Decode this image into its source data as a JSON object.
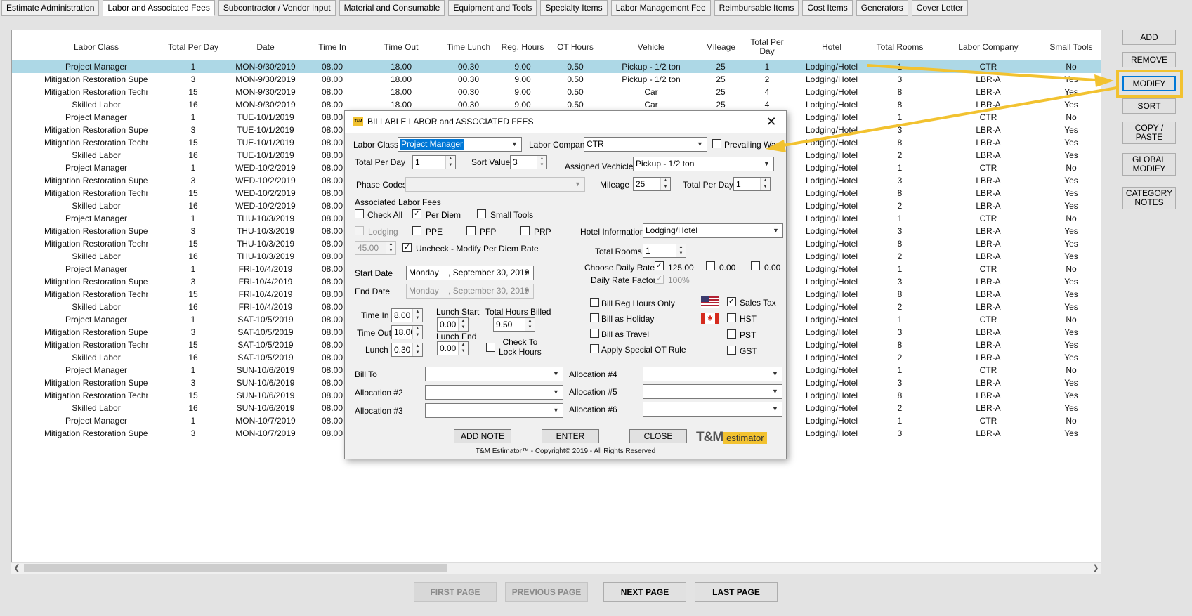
{
  "tabs": [
    "Estimate Administration",
    "Labor and Associated Fees",
    "Subcontractor / Vendor Input",
    "Material and Consumable",
    "Equipment and Tools",
    "Specialty Items",
    "Labor Management Fee",
    "Reimbursable Items",
    "Cost Items",
    "Generators",
    "Cover Letter"
  ],
  "active_tab": "Labor and Associated Fees",
  "grid": {
    "columns": [
      "Labor Class",
      "Total Per Day",
      "Date",
      "Time In",
      "Time Out",
      "Time Lunch",
      "Reg. Hours",
      "OT Hours",
      "Vehicle",
      "Mileage",
      "Total Per Day",
      "Hotel",
      "Total Rooms",
      "Labor Company",
      "Small Tools"
    ],
    "rows": [
      [
        "Project Manager",
        "1",
        "MON-9/30/2019",
        "08.00",
        "18.00",
        "00.30",
        "9.00",
        "0.50",
        "Pickup - 1/2 ton",
        "25",
        "1",
        "Lodging/Hotel",
        "1",
        "CTR",
        "No"
      ],
      [
        "Mitigation Restoration Supervisor",
        "3",
        "MON-9/30/2019",
        "08.00",
        "18.00",
        "00.30",
        "9.00",
        "0.50",
        "Pickup - 1/2 ton",
        "25",
        "2",
        "Lodging/Hotel",
        "3",
        "LBR-A",
        "Yes"
      ],
      [
        "Mitigation Restoration Technician",
        "15",
        "MON-9/30/2019",
        "08.00",
        "18.00",
        "00.30",
        "9.00",
        "0.50",
        "Car",
        "25",
        "4",
        "Lodging/Hotel",
        "8",
        "LBR-A",
        "Yes"
      ],
      [
        "Skilled Labor",
        "16",
        "MON-9/30/2019",
        "08.00",
        "18.00",
        "00.30",
        "9.00",
        "0.50",
        "Car",
        "25",
        "4",
        "Lodging/Hotel",
        "8",
        "LBR-A",
        "Yes"
      ],
      [
        "Project Manager",
        "1",
        "TUE-10/1/2019",
        "08.00",
        "",
        "",
        "",
        "",
        "",
        "",
        "",
        "Lodging/Hotel",
        "1",
        "CTR",
        "No"
      ],
      [
        "Mitigation Restoration Supervisor",
        "3",
        "TUE-10/1/2019",
        "08.00",
        "",
        "",
        "",
        "",
        "",
        "",
        "",
        "Lodging/Hotel",
        "3",
        "LBR-A",
        "Yes"
      ],
      [
        "Mitigation Restoration Technician",
        "15",
        "TUE-10/1/2019",
        "08.00",
        "",
        "",
        "",
        "",
        "",
        "",
        "",
        "Lodging/Hotel",
        "8",
        "LBR-A",
        "Yes"
      ],
      [
        "Skilled Labor",
        "16",
        "TUE-10/1/2019",
        "08.00",
        "",
        "",
        "",
        "",
        "",
        "",
        "",
        "Lodging/Hotel",
        "2",
        "LBR-A",
        "Yes"
      ],
      [
        "Project Manager",
        "1",
        "WED-10/2/2019",
        "08.00",
        "",
        "",
        "",
        "",
        "",
        "",
        "",
        "Lodging/Hotel",
        "1",
        "CTR",
        "No"
      ],
      [
        "Mitigation Restoration Supervisor",
        "3",
        "WED-10/2/2019",
        "08.00",
        "",
        "",
        "",
        "",
        "",
        "",
        "",
        "Lodging/Hotel",
        "3",
        "LBR-A",
        "Yes"
      ],
      [
        "Mitigation Restoration Technician",
        "15",
        "WED-10/2/2019",
        "08.00",
        "",
        "",
        "",
        "",
        "",
        "",
        "",
        "Lodging/Hotel",
        "8",
        "LBR-A",
        "Yes"
      ],
      [
        "Skilled Labor",
        "16",
        "WED-10/2/2019",
        "08.00",
        "",
        "",
        "",
        "",
        "",
        "",
        "",
        "Lodging/Hotel",
        "2",
        "LBR-A",
        "Yes"
      ],
      [
        "Project Manager",
        "1",
        "THU-10/3/2019",
        "08.00",
        "",
        "",
        "",
        "",
        "",
        "",
        "",
        "Lodging/Hotel",
        "1",
        "CTR",
        "No"
      ],
      [
        "Mitigation Restoration Supervisor",
        "3",
        "THU-10/3/2019",
        "08.00",
        "",
        "",
        "",
        "",
        "",
        "",
        "",
        "Lodging/Hotel",
        "3",
        "LBR-A",
        "Yes"
      ],
      [
        "Mitigation Restoration Technician",
        "15",
        "THU-10/3/2019",
        "08.00",
        "",
        "",
        "",
        "",
        "",
        "",
        "",
        "Lodging/Hotel",
        "8",
        "LBR-A",
        "Yes"
      ],
      [
        "Skilled Labor",
        "16",
        "THU-10/3/2019",
        "08.00",
        "",
        "",
        "",
        "",
        "",
        "",
        "",
        "Lodging/Hotel",
        "2",
        "LBR-A",
        "Yes"
      ],
      [
        "Project Manager",
        "1",
        "FRI-10/4/2019",
        "08.00",
        "",
        "",
        "",
        "",
        "",
        "",
        "",
        "Lodging/Hotel",
        "1",
        "CTR",
        "No"
      ],
      [
        "Mitigation Restoration Supervisor",
        "3",
        "FRI-10/4/2019",
        "08.00",
        "",
        "",
        "",
        "",
        "",
        "",
        "",
        "Lodging/Hotel",
        "3",
        "LBR-A",
        "Yes"
      ],
      [
        "Mitigation Restoration Technician",
        "15",
        "FRI-10/4/2019",
        "08.00",
        "",
        "",
        "",
        "",
        "",
        "",
        "",
        "Lodging/Hotel",
        "8",
        "LBR-A",
        "Yes"
      ],
      [
        "Skilled Labor",
        "16",
        "FRI-10/4/2019",
        "08.00",
        "",
        "",
        "",
        "",
        "",
        "",
        "",
        "Lodging/Hotel",
        "2",
        "LBR-A",
        "Yes"
      ],
      [
        "Project Manager",
        "1",
        "SAT-10/5/2019",
        "08.00",
        "",
        "",
        "",
        "",
        "",
        "",
        "",
        "Lodging/Hotel",
        "1",
        "CTR",
        "No"
      ],
      [
        "Mitigation Restoration Supervisor",
        "3",
        "SAT-10/5/2019",
        "08.00",
        "",
        "",
        "",
        "",
        "",
        "",
        "",
        "Lodging/Hotel",
        "3",
        "LBR-A",
        "Yes"
      ],
      [
        "Mitigation Restoration Technician",
        "15",
        "SAT-10/5/2019",
        "08.00",
        "",
        "",
        "",
        "",
        "",
        "",
        "",
        "Lodging/Hotel",
        "8",
        "LBR-A",
        "Yes"
      ],
      [
        "Skilled Labor",
        "16",
        "SAT-10/5/2019",
        "08.00",
        "",
        "",
        "",
        "",
        "",
        "",
        "",
        "Lodging/Hotel",
        "2",
        "LBR-A",
        "Yes"
      ],
      [
        "Project Manager",
        "1",
        "SUN-10/6/2019",
        "08.00",
        "",
        "",
        "",
        "",
        "",
        "",
        "",
        "Lodging/Hotel",
        "1",
        "CTR",
        "No"
      ],
      [
        "Mitigation Restoration Supervisor",
        "3",
        "SUN-10/6/2019",
        "08.00",
        "",
        "",
        "",
        "",
        "",
        "",
        "",
        "Lodging/Hotel",
        "3",
        "LBR-A",
        "Yes"
      ],
      [
        "Mitigation Restoration Technician",
        "15",
        "SUN-10/6/2019",
        "08.00",
        "",
        "",
        "",
        "",
        "",
        "",
        "",
        "Lodging/Hotel",
        "8",
        "LBR-A",
        "Yes"
      ],
      [
        "Skilled Labor",
        "16",
        "SUN-10/6/2019",
        "08.00",
        "",
        "",
        "",
        "",
        "",
        "",
        "",
        "Lodging/Hotel",
        "2",
        "LBR-A",
        "Yes"
      ],
      [
        "Project Manager",
        "1",
        "MON-10/7/2019",
        "08.00",
        "",
        "",
        "",
        "",
        "",
        "",
        "",
        "Lodging/Hotel",
        "1",
        "CTR",
        "No"
      ],
      [
        "Mitigation Restoration Supervisor",
        "3",
        "MON-10/7/2019",
        "08.00",
        "",
        "",
        "",
        "",
        "",
        "",
        "",
        "Lodging/Hotel",
        "3",
        "LBR-A",
        "Yes"
      ]
    ]
  },
  "side_buttons": [
    "ADD",
    "REMOVE",
    "MODIFY",
    "SORT",
    "COPY / PASTE",
    "GLOBAL MODIFY",
    "CATEGORY NOTES"
  ],
  "pager": {
    "first": "FIRST PAGE",
    "previous": "PREVIOUS PAGE",
    "next": "NEXT PAGE",
    "last": "LAST PAGE"
  },
  "dialog": {
    "title": "BILLABLE LABOR and ASSOCIATED FEES",
    "logo_text": "T&M",
    "labor_class_label": "Labor Class",
    "labor_class": "Project Manager",
    "labor_company_label": "Labor Company",
    "labor_company": "CTR",
    "prevailing_wage_label": "Prevailing Wage",
    "total_per_day_label": "Total Per Day",
    "total_per_day": "1",
    "sort_value_label": "Sort Value",
    "sort_value": "3",
    "assigned_vehicle_label": "Assigned Vechicle",
    "assigned_vehicle": "Pickup - 1/2 ton",
    "phase_codes_label": "Phase Codes",
    "phase_codes": "",
    "mileage_label": "Mileage",
    "mileage": "25",
    "vehicle_total_per_day_label": "Total Per Day",
    "vehicle_total_per_day": "1",
    "associated_fees_label": "Associated Labor Fees",
    "check_all_label": "Check All",
    "per_diem_label": "Per Diem",
    "small_tools_label": "Small Tools",
    "lodging_label": "Lodging",
    "ppe_label": "PPE",
    "pfp_label": "PFP",
    "prp_label": "PRP",
    "per_diem_rate": "45.00",
    "uncheck_modify_label": "Uncheck - Modify Per Diem Rate",
    "hotel_information_label": "Hotel Information",
    "hotel_information": "Lodging/Hotel",
    "total_rooms_label": "Total Rooms",
    "total_rooms": "1",
    "choose_daily_rate_label": "Choose Daily Rate",
    "rate_1": "125.00",
    "rate_2": "0.00",
    "rate_3": "0.00",
    "daily_rate_factor_label": "Daily Rate Factor",
    "daily_rate_factor": "100%",
    "start_date_label": "Start Date",
    "start_date": "Monday    , September 30, 2019",
    "end_date_label": "End Date",
    "end_date": "Monday    , September 30, 2019",
    "time_in_label": "Time In",
    "time_in": "8.00",
    "time_out_label": "Time Out",
    "time_out": "18.00",
    "lunch_label": "Lunch",
    "lunch": "0.30",
    "lunch_start_label": "Lunch Start",
    "lunch_start": "0.00",
    "lunch_end_label": "Lunch End",
    "lunch_end": "0.00",
    "total_hours_billed_label": "Total Hours Billed",
    "total_hours_billed": "9.50",
    "check_to_lock_label": "Check To\nLock Hours",
    "bill_reg_hours_label": "Bill Reg Hours Only",
    "bill_holiday_label": "Bill as Holiday",
    "bill_travel_label": "Bill as Travel",
    "special_ot_label": "Apply Special OT Rule",
    "sales_tax_label": "Sales Tax",
    "hst_label": "HST",
    "pst_label": "PST",
    "gst_label": "GST",
    "bill_to_label": "Bill To",
    "allocation_2_label": "Allocation #2",
    "allocation_3_label": "Allocation #3",
    "allocation_4_label": "Allocation #4",
    "allocation_5_label": "Allocation #5",
    "allocation_6_label": "Allocation #6",
    "add_note": "ADD NOTE",
    "enter": "ENTER",
    "close": "CLOSE",
    "brand_tm": "T&M",
    "brand_est": "estimator",
    "copyright": "T&M Estimator™ - Copyright© 2019 - All Rights Reserved"
  },
  "colors": {
    "highlight": "#f2c230",
    "selected_row": "#add8e6",
    "accent": "#0078d7"
  }
}
